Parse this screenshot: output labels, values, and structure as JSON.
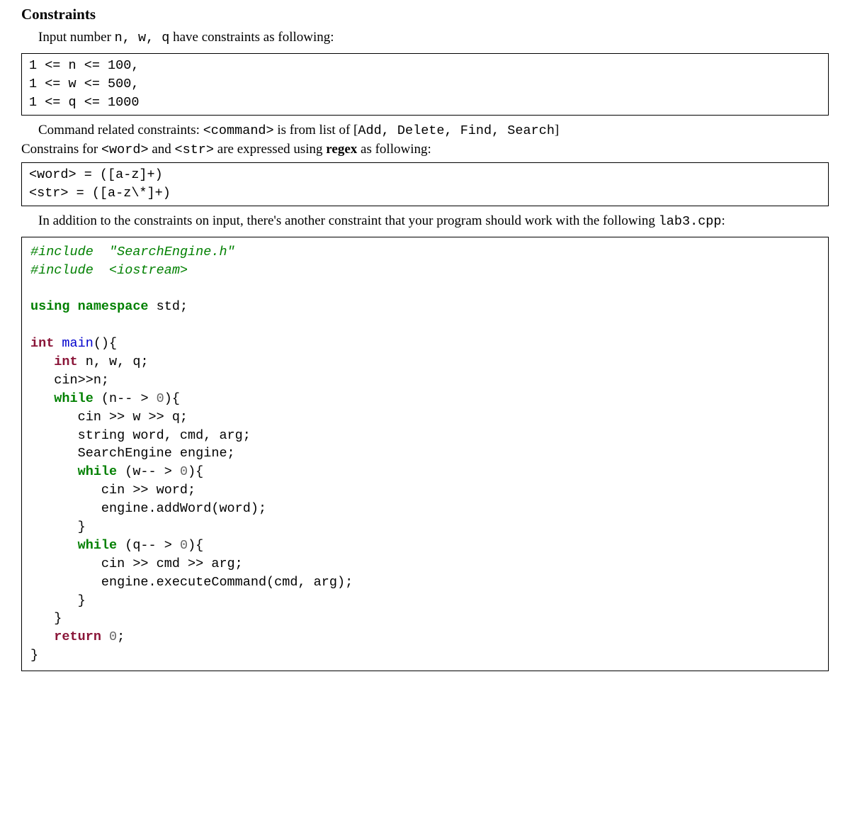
{
  "title": "Constraints",
  "intro_pre": "Input number ",
  "intro_vars": "n, w, q",
  "intro_post": " have constraints as following:",
  "box1": "1 <= n <= 100,\n1 <= w <= 500,\n1 <= q <= 1000",
  "cmd_line_pre": "Command related constraints: ",
  "cmd_tag": "<command>",
  "cmd_line_mid": " is from list of [",
  "cmd_list": "Add, Delete, Find, Search",
  "cmd_line_post": "]",
  "constr2_pre": "Constrains for ",
  "word_tag": "<word>",
  "constr2_and": " and ",
  "str_tag": "<str>",
  "constr2_mid": " are expressed using ",
  "regex_word": "regex",
  "constr2_post": " as following:",
  "box2": "<word> = ([a-z]+)\n<str> = ([a-z\\*]+)",
  "para_addl_1": "In addition to the constraints on input, there's another constraint that your program should work with the following ",
  "lab3": "lab3.cpp",
  "para_addl_2": ":",
  "code": {
    "l1a": "#include ",
    "l1b": " \"SearchEngine.h\"",
    "l2a": "#include ",
    "l2b": " <iostream>",
    "blank": "",
    "l3a": "using",
    "l3b": " namespace",
    "l3c": " std;",
    "l4a": "int",
    "l4b": " main",
    "l4c": "(){",
    "l5a": "   int",
    "l5b": " n, w, q;",
    "l6": "   cin>>n;",
    "l7a": "   while",
    "l7b": " (n-- > ",
    "l7c": "0",
    "l7d": "){",
    "l8": "      cin >> w >> q;",
    "l9": "      string word, cmd, arg;",
    "l10": "      SearchEngine engine;",
    "l11a": "      while",
    "l11b": " (w-- > ",
    "l11c": "0",
    "l11d": "){",
    "l12": "         cin >> word;",
    "l13": "         engine.addWord(word);",
    "l14": "      }",
    "l15a": "      while",
    "l15b": " (q-- > ",
    "l15c": "0",
    "l15d": "){",
    "l16": "         cin >> cmd >> arg;",
    "l17": "         engine.executeCommand(cmd, arg);",
    "l18": "      }",
    "l19": "   }",
    "l20a": "   return",
    "l20b": " 0",
    "l20c": ";",
    "l21": "}"
  }
}
